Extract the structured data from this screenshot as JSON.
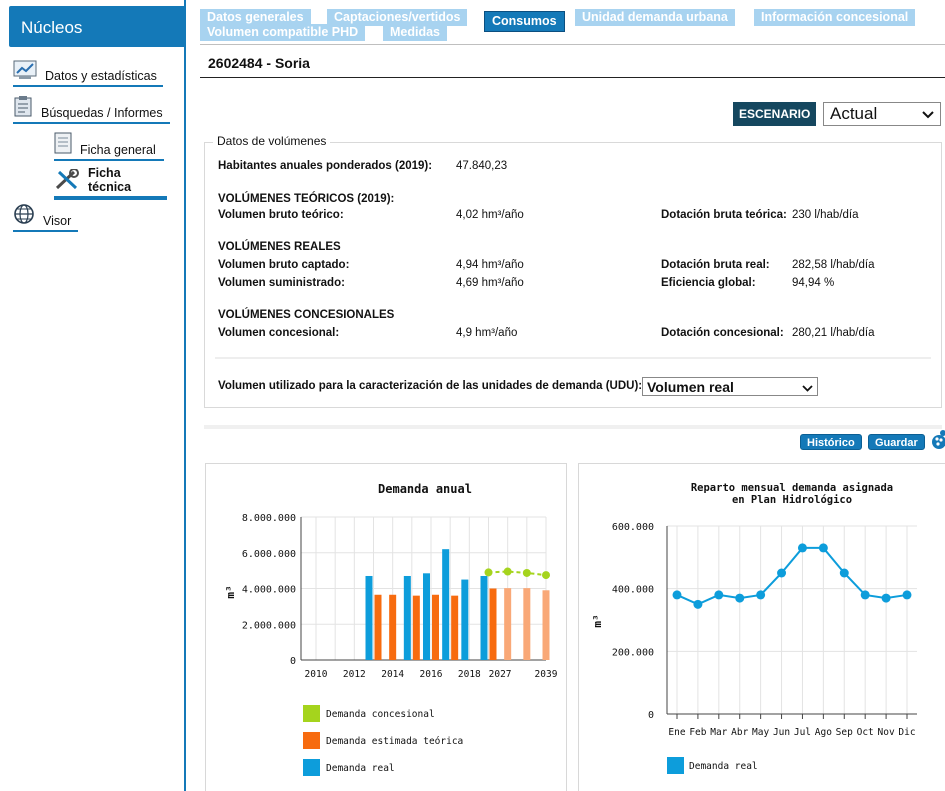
{
  "sidebar": {
    "header": "Núcleos",
    "items": [
      {
        "label": "Datos y estadísticas",
        "icon": "statistics-icon"
      },
      {
        "label": "Búsquedas / Informes",
        "icon": "clipboard-icon"
      },
      {
        "label": "Ficha general",
        "icon": "document-icon"
      },
      {
        "label": "Ficha técnica",
        "icon": "tools-icon"
      },
      {
        "label": "Visor",
        "icon": "globe-icon"
      }
    ]
  },
  "tabs": [
    {
      "label": "Datos generales",
      "active": false
    },
    {
      "label": "Captaciones/vertidos",
      "active": false
    },
    {
      "label": "Consumos",
      "active": true
    },
    {
      "label": "Unidad demanda urbana",
      "active": false
    },
    {
      "label": "Información concesional",
      "active": false
    },
    {
      "label": "Volumen compatible PHD",
      "active": false
    },
    {
      "label": "Medidas",
      "active": false
    }
  ],
  "page_title": "2602484 - Soria",
  "escenario": {
    "label": "ESCENARIO",
    "value": "Actual"
  },
  "volumes": {
    "legend": "Datos de volúmenes",
    "habitantes_label": "Habitantes anuales ponderados (2019):",
    "habitantes_value": "47.840,23",
    "teoricos_heading": "VOLÚMENES TEÓRICOS (2019):",
    "bruto_teorico_label": "Volumen bruto teórico:",
    "bruto_teorico_value": "4,02 hm³/año",
    "dotacion_teorica_label": "Dotación bruta teórica:",
    "dotacion_teorica_value": "230 l/hab/día",
    "reales_heading": "VOLÚMENES REALES",
    "bruto_captado_label": "Volumen bruto captado:",
    "bruto_captado_value": "4,94 hm³/año",
    "dotacion_real_label": "Dotación bruta real:",
    "dotacion_real_value": "282,58 l/hab/día",
    "suministrado_label": "Volumen suministrado:",
    "suministrado_value": "4,69 hm³/año",
    "eficiencia_label": "Eficiencia global:",
    "eficiencia_value": "94,94 %",
    "concesionales_heading": "VOLÚMENES CONCESIONALES",
    "concesional_label": "Volumen concesional:",
    "concesional_value": "4,9 hm³/año",
    "dotacion_concesional_label": "Dotación concesional:",
    "dotacion_concesional_value": "280,21 l/hab/día",
    "udu_label": "Volumen utilizado para la caracterización de las unidades de demanda (UDU):",
    "udu_value": "Volumen real"
  },
  "buttons": {
    "historico": "Histórico",
    "guardar": "Guardar"
  },
  "colors": {
    "accent": "#1479b8",
    "real": "#0d9ddb",
    "teorica": "#f76b0f",
    "teorica_future": "#f9a877",
    "concesional": "#a5d41d"
  },
  "chart_data": [
    {
      "type": "bar",
      "title": "Demanda anual",
      "ylabel": "m³",
      "ylim": [
        0,
        8000000
      ],
      "yticks": [
        0,
        2000000,
        4000000,
        6000000,
        8000000
      ],
      "ytick_labels": [
        "0",
        "2.000.000",
        "4.000.000",
        "6.000.000",
        "8.000.000"
      ],
      "xtick_labels": [
        "2010",
        "2012",
        "2014",
        "2016",
        "2018",
        "2027",
        "2039"
      ],
      "categories": [
        "2010",
        "2011",
        "2012",
        "2013",
        "2014",
        "2015",
        "2016",
        "2017",
        "2018",
        "2019",
        "2027",
        "2033",
        "2039"
      ],
      "series": [
        {
          "name": "Demanda concesional",
          "kind": "line",
          "values": [
            null,
            null,
            null,
            null,
            null,
            null,
            null,
            null,
            null,
            4900000,
            4950000,
            4870000,
            4750000
          ]
        },
        {
          "name": "Demanda estimada teórica",
          "kind": "bar",
          "values": [
            null,
            null,
            null,
            3650000,
            3650000,
            3600000,
            3650000,
            3600000,
            null,
            4000000,
            4020000,
            4020000,
            3900000
          ]
        },
        {
          "name": "Demanda real",
          "kind": "bar",
          "values": [
            null,
            null,
            null,
            4700000,
            null,
            4700000,
            4850000,
            6200000,
            4500000,
            4700000,
            null,
            null,
            null
          ]
        }
      ],
      "legend": [
        "Demanda concesional",
        "Demanda estimada teórica",
        "Demanda real"
      ],
      "legend_position": "bottom",
      "grid": true
    },
    {
      "type": "line",
      "title": "Reparto mensual demanda asignada en Plan Hidrológico",
      "title_lines": [
        "Reparto mensual demanda asignada",
        "en Plan Hidrológico"
      ],
      "ylabel": "m³",
      "ylim": [
        0,
        600000
      ],
      "yticks": [
        0,
        200000,
        400000,
        600000
      ],
      "ytick_labels": [
        "0",
        "200.000",
        "400.000",
        "600.000"
      ],
      "categories": [
        "Ene",
        "Feb",
        "Mar",
        "Abr",
        "May",
        "Jun",
        "Jul",
        "Ago",
        "Sep",
        "Oct",
        "Nov",
        "Dic"
      ],
      "series": [
        {
          "name": "Demanda real",
          "values": [
            380000,
            350000,
            380000,
            370000,
            380000,
            450000,
            530000,
            530000,
            450000,
            380000,
            370000,
            380000
          ]
        }
      ],
      "legend": [
        "Demanda real"
      ],
      "legend_position": "bottom",
      "grid": true
    }
  ]
}
